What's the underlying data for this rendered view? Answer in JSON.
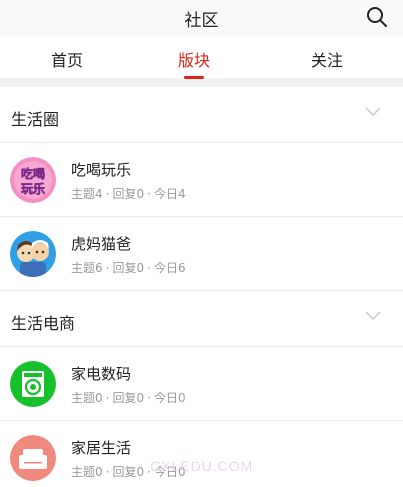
{
  "header": {
    "title": "社区",
    "search_icon": "search-icon"
  },
  "tabs": [
    {
      "label": "首页",
      "active": false
    },
    {
      "label": "版块",
      "active": true
    },
    {
      "label": "关注",
      "active": false
    }
  ],
  "accent_color": "#e2231a",
  "sections": [
    {
      "title": "生活圈",
      "items": [
        {
          "name": "吃喝玩乐",
          "icon": "food-fun-badge-icon",
          "icon_text_top": "吃喝",
          "icon_text_bottom": "玩乐",
          "topics_label": "主题4",
          "replies_label": "回复0",
          "today_label": "今日4"
        },
        {
          "name": "虎妈猫爸",
          "icon": "parents-cartoon-icon",
          "topics_label": "主题6",
          "replies_label": "回复0",
          "today_label": "今日6"
        }
      ]
    },
    {
      "title": "生活电商",
      "items": [
        {
          "name": "家电数码",
          "icon": "washing-machine-icon",
          "topics_label": "主题0",
          "replies_label": "回复0",
          "today_label": "今日0"
        },
        {
          "name": "家居生活",
          "icon": "sofa-icon",
          "topics_label": "主题0",
          "replies_label": "回复0",
          "today_label": "今日0"
        }
      ]
    }
  ],
  "separator": "·",
  "watermark": "CXLEDU.COM"
}
